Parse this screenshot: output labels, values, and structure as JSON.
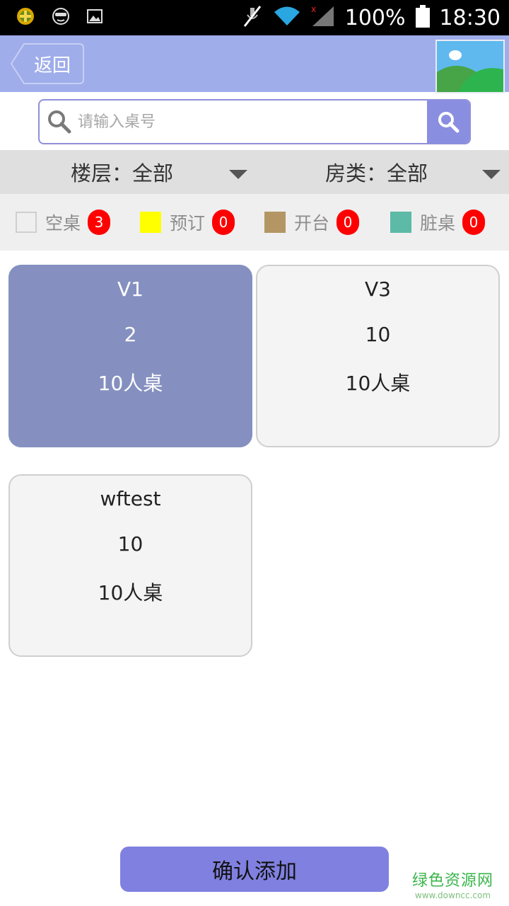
{
  "status_bar": {
    "battery": "100%",
    "time": "18:30",
    "icons": [
      "app-badge-icon",
      "face-icon",
      "image-icon",
      "mute-icon",
      "wifi-icon",
      "signal-icon",
      "battery-icon"
    ]
  },
  "header": {
    "back_label": "返回",
    "colors": {
      "bar": "#9fadea"
    }
  },
  "search": {
    "placeholder": "请输入桌号",
    "value": ""
  },
  "filters": {
    "floor": "楼层：全部",
    "room_type": "房类：全部"
  },
  "legend": [
    {
      "label": "空桌",
      "count": "3",
      "color": "#ffffff"
    },
    {
      "label": "预订",
      "count": "0",
      "color": "#ffff00"
    },
    {
      "label": "开台",
      "count": "0",
      "color": "#b39664"
    },
    {
      "label": "脏桌",
      "count": "0",
      "color": "#5cbaa7"
    }
  ],
  "tables": [
    {
      "name": "V1",
      "count": "2",
      "type": "10人桌",
      "selected": true
    },
    {
      "name": "V3",
      "count": "10",
      "type": "10人桌",
      "selected": false
    },
    {
      "name": "wftest",
      "count": "10",
      "type": "10人桌",
      "selected": false
    }
  ],
  "confirm_label": "确认添加",
  "watermark": {
    "cn": "绿色资源网",
    "en": "www.downcc.com"
  }
}
